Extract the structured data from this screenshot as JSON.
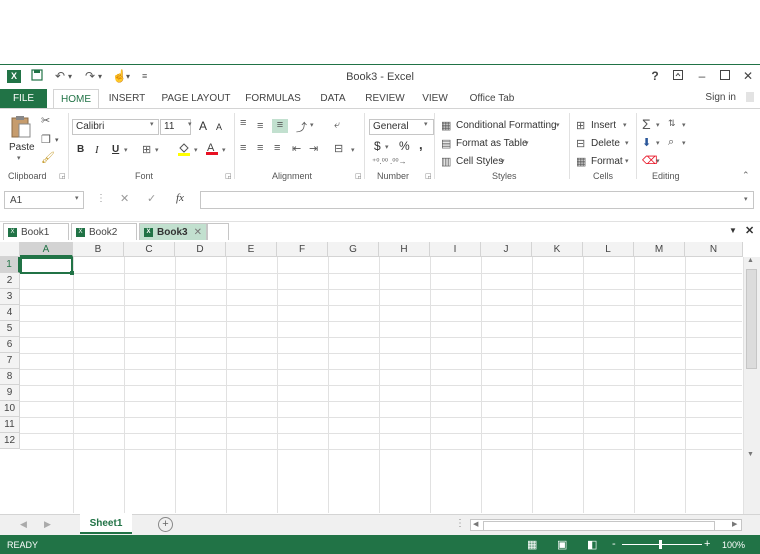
{
  "title_bar": {
    "app_icon": "X",
    "title": "Book3 - Excel",
    "help": "?",
    "controls": [
      "restore-ribbon",
      "minimize",
      "maximize",
      "close"
    ]
  },
  "menu_tabs": [
    {
      "label": "FILE"
    },
    {
      "label": "HOME"
    },
    {
      "label": "INSERT"
    },
    {
      "label": "PAGE LAYOUT"
    },
    {
      "label": "FORMULAS"
    },
    {
      "label": "DATA"
    },
    {
      "label": "REVIEW"
    },
    {
      "label": "VIEW"
    },
    {
      "label": "Office Tab"
    }
  ],
  "sign_in": "Sign in",
  "ribbon": {
    "clipboard": {
      "paste": "Paste",
      "label": "Clipboard"
    },
    "font": {
      "name": "Calibri",
      "size": "11",
      "bold": "B",
      "italic": "I",
      "underline": "U",
      "grow": "A",
      "shrink": "A",
      "label": "Font"
    },
    "alignment": {
      "label": "Alignment"
    },
    "number": {
      "format": "General",
      "currency": "$",
      "percent": "%",
      "comma": ",",
      "label": "Number"
    },
    "styles": {
      "conditional": "Conditional Formatting",
      "as_table": "Format as Table",
      "cell_styles": "Cell Styles",
      "label": "Styles"
    },
    "cells": {
      "insert": "Insert",
      "delete": "Delete",
      "format": "Format",
      "label": "Cells"
    },
    "editing": {
      "label": "Editing"
    }
  },
  "formula_bar": {
    "name_box": "A1",
    "fx": "fx",
    "value": ""
  },
  "doc_tabs": [
    {
      "label": "Book1",
      "active": false
    },
    {
      "label": "Book2",
      "active": false
    },
    {
      "label": "Book3",
      "active": true
    }
  ],
  "grid": {
    "columns": [
      "A",
      "B",
      "C",
      "D",
      "E",
      "F",
      "G",
      "H",
      "I",
      "J",
      "K",
      "L",
      "M",
      "N"
    ],
    "rows": [
      "1",
      "2",
      "3",
      "4",
      "5",
      "6",
      "7",
      "8",
      "9",
      "10",
      "11",
      "12"
    ],
    "selected_cell": "A1"
  },
  "sheet_tabs": [
    {
      "label": "Sheet1",
      "active": true
    }
  ],
  "status_bar": {
    "state": "READY",
    "zoom": "100%",
    "zoom_minus": "-",
    "zoom_plus": "+"
  },
  "colors": {
    "accent": "#217346",
    "active_tab": "#c2e0cf"
  }
}
